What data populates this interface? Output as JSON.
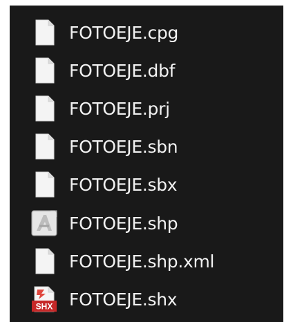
{
  "files": [
    {
      "name": "FOTOEJE.cpg",
      "icon": "blank-file-icon"
    },
    {
      "name": "FOTOEJE.dbf",
      "icon": "blank-file-icon"
    },
    {
      "name": "FOTOEJE.prj",
      "icon": "blank-file-icon"
    },
    {
      "name": "FOTOEJE.sbn",
      "icon": "blank-file-icon"
    },
    {
      "name": "FOTOEJE.sbx",
      "icon": "blank-file-icon"
    },
    {
      "name": "FOTOEJE.shp",
      "icon": "autocad-file-icon"
    },
    {
      "name": "FOTOEJE.shp.xml",
      "icon": "blank-file-icon"
    },
    {
      "name": "FOTOEJE.shx",
      "icon": "shx-file-icon",
      "badge": "SHX"
    }
  ],
  "colors": {
    "background": "#191919",
    "text": "#f2f2f2",
    "shx_accent": "#d32f2f"
  }
}
